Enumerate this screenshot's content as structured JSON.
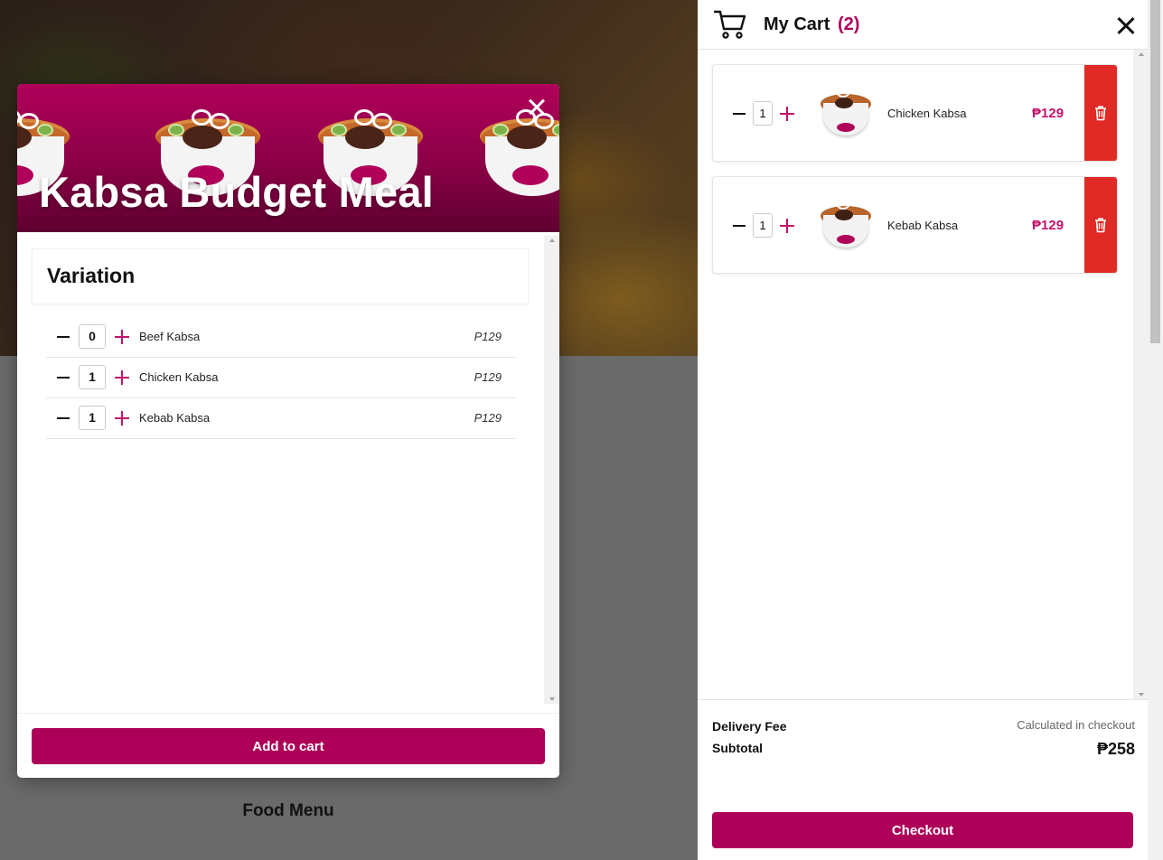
{
  "background": {
    "section_title": "Food Menu"
  },
  "modal": {
    "title": "Kabsa Budget Meal",
    "section_title": "Variation",
    "variations": [
      {
        "name": "Beef Kabsa",
        "qty": "0",
        "price": "P129"
      },
      {
        "name": "Chicken Kabsa",
        "qty": "1",
        "price": "P129"
      },
      {
        "name": "Kebab Kabsa",
        "qty": "1",
        "price": "P129"
      }
    ],
    "add_to_cart_label": "Add to cart"
  },
  "cart": {
    "title": "My Cart",
    "count": "(2)",
    "items": [
      {
        "name": "Chicken Kabsa",
        "qty": "1",
        "price": "₱129"
      },
      {
        "name": "Kebab Kabsa",
        "qty": "1",
        "price": "₱129"
      }
    ],
    "delivery_fee_label": "Delivery Fee",
    "delivery_fee_value": "Calculated in checkout",
    "subtotal_label": "Subtotal",
    "subtotal_value": "₱258",
    "checkout_label": "Checkout"
  },
  "colors": {
    "brand": "#ad0058",
    "accent": "#c4136c",
    "delete": "#df2a25"
  },
  "icons": {
    "cart": "shopping-cart-icon",
    "close": "close-icon",
    "delete": "trash-icon",
    "minus": "minus-icon",
    "plus": "plus-icon"
  }
}
